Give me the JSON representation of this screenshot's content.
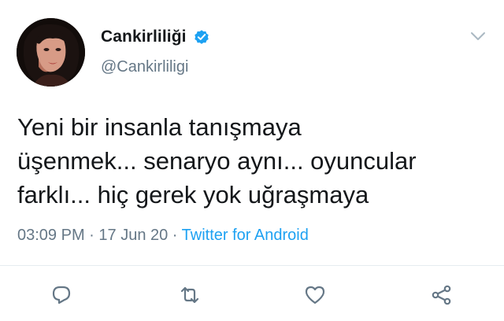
{
  "author": {
    "display_name": "Cankirliliği",
    "handle": "@Cankirliligi",
    "verified": true,
    "avatar_icon": "profile-avatar"
  },
  "tweet": {
    "lines": [
      "Yeni bir insanla tanışmaya",
      "üşenmek... senaryo aynı... oyuncular",
      "farklı... hiç gerek yok uğraşmaya"
    ]
  },
  "meta": {
    "time": "03:09 PM",
    "sep1": " · ",
    "date": "17 Jun 20",
    "sep2": " · ",
    "source": "Twitter for Android"
  },
  "actions": [
    {
      "name": "reply",
      "icon": "reply-icon"
    },
    {
      "name": "retweet",
      "icon": "retweet-icon"
    },
    {
      "name": "like",
      "icon": "heart-icon"
    },
    {
      "name": "share",
      "icon": "share-icon"
    }
  ],
  "colors": {
    "accent": "#1da1f2",
    "text": "#14171a",
    "muted": "#657786",
    "icon": "#657786"
  }
}
